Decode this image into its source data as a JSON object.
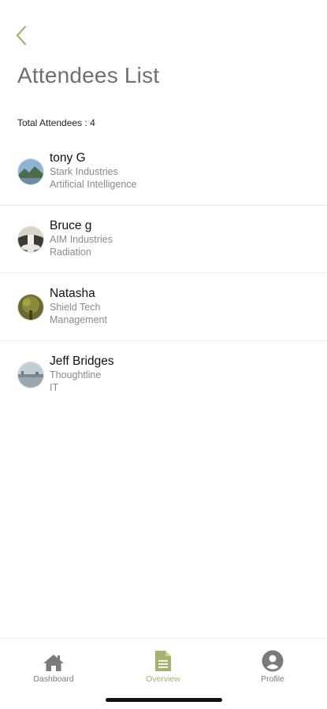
{
  "header": {
    "title": "Attendees List",
    "total_label": "Total Attendees : 4"
  },
  "colors": {
    "accent": "#a3b26d",
    "title": "#6e6e73",
    "subtext": "#8a8a8e"
  },
  "attendees": [
    {
      "name": "tony G",
      "company": "Stark Industries",
      "field": "Artificial Intelligence",
      "avatar_icon": "landscape-photo"
    },
    {
      "name": "Bruce g",
      "company": "AIM Industries",
      "field": "Radiation",
      "avatar_icon": "waterfall-photo"
    },
    {
      "name": "Natasha",
      "company": "Shield Tech",
      "field": "Management",
      "avatar_icon": "tree-photo"
    },
    {
      "name": "Jeff Bridges",
      "company": "Thoughtline",
      "field": "IT",
      "avatar_icon": "city-photo"
    }
  ],
  "tabbar": {
    "tabs": [
      {
        "label": "Dashboard",
        "icon": "home-icon",
        "active": false
      },
      {
        "label": "Overview",
        "icon": "document-icon",
        "active": true
      },
      {
        "label": "Profile",
        "icon": "user-circle-icon",
        "active": false
      }
    ]
  }
}
